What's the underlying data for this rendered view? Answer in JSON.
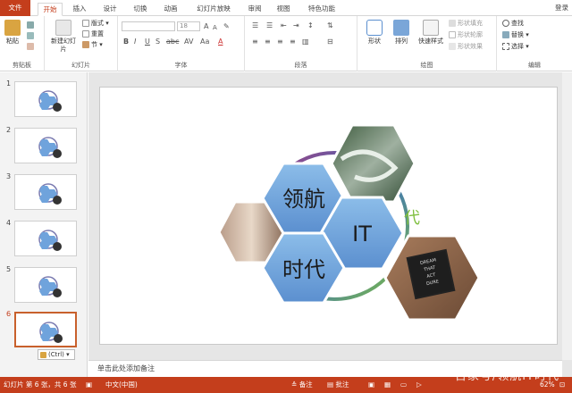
{
  "tabs": [
    "文件",
    "开始",
    "插入",
    "设计",
    "切换",
    "动画",
    "幻灯片放映",
    "审阅",
    "视图",
    "特色功能"
  ],
  "login": "登录",
  "ribbon": {
    "clipboard": {
      "label": "剪贴板",
      "paste": "粘贴"
    },
    "slides": {
      "label": "幻灯片",
      "new_slide": "新建幻灯片",
      "layout": "版式",
      "reset": "重置",
      "section": "节"
    },
    "font": {
      "label": "字体",
      "size": "18"
    },
    "paragraph": {
      "label": "段落"
    },
    "drawing": {
      "label": "绘图",
      "shape": "形状",
      "arrange": "排列",
      "quick_styles": "快速样式",
      "fill": "形状填充",
      "outline": "形状轮廓",
      "effects": "形状效果"
    },
    "editing": {
      "label": "编辑",
      "find": "查找",
      "replace": "替换",
      "select": "选择"
    }
  },
  "thumbnails": [
    "1",
    "2",
    "3",
    "4",
    "5",
    "6"
  ],
  "paste_option": "(Ctrl)",
  "slide": {
    "hex1": "领航",
    "hex2": "时代",
    "hex3": "IT",
    "board_text": [
      "DREAM",
      "THAT",
      "ACT",
      "DURE"
    ]
  },
  "notes_placeholder": "单击此处添加备注",
  "status": {
    "slide_info": "幻灯片 第 6 张，共 6 张",
    "language": "中文(中国)",
    "notes": "备注",
    "comments": "批注",
    "zoom": "62%"
  },
  "watermark": "百家号/领航IT时代",
  "colors": {
    "accent": "#c43e1c",
    "hex_fill": "#6fa3dc"
  }
}
